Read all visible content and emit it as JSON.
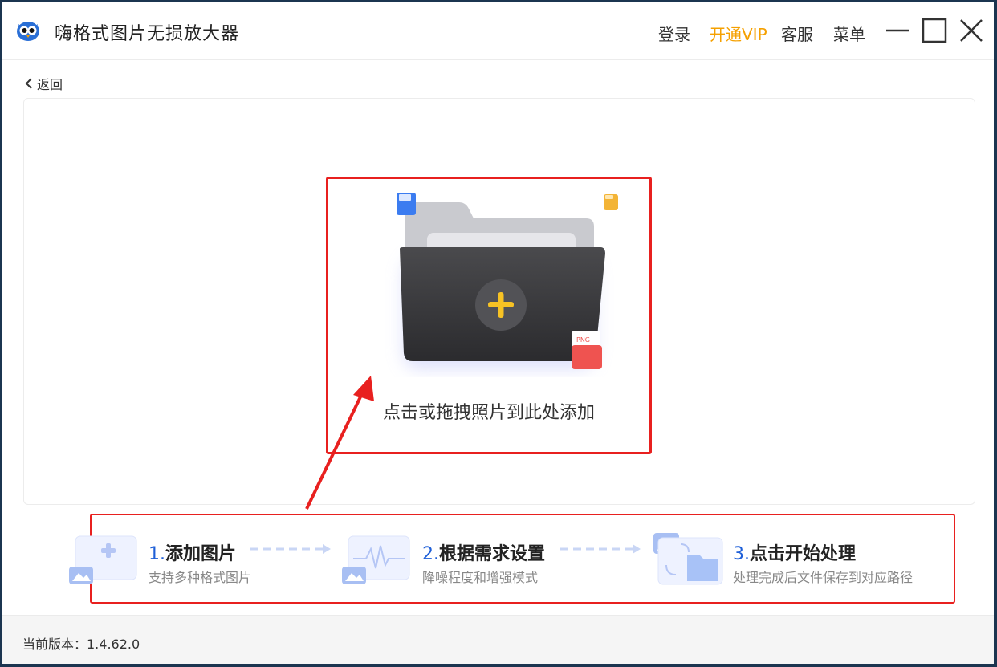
{
  "app": {
    "title": "嗨格式图片无损放大器"
  },
  "header": {
    "login": "登录",
    "vip": "开通VIP",
    "service": "客服",
    "menu": "菜单"
  },
  "nav": {
    "back": "返回"
  },
  "drop": {
    "hint": "点击或拖拽照片到此处添加",
    "badges": [
      "PNG"
    ]
  },
  "steps": [
    {
      "num": "1.",
      "title": "添加图片",
      "desc": "支持多种格式图片"
    },
    {
      "num": "2.",
      "title": "根据需求设置",
      "desc": "降噪程度和增强模式"
    },
    {
      "num": "3.",
      "title": "点击开始处理",
      "desc": "处理完成后文件保存到对应路径"
    }
  ],
  "footer": {
    "version_label": "当前版本：1.4.62.0"
  },
  "colors": {
    "accent_blue": "#1e5fd8",
    "vip_orange": "#f5a000",
    "annotation_red": "#e8201f",
    "plus_yellow": "#f7c224"
  }
}
